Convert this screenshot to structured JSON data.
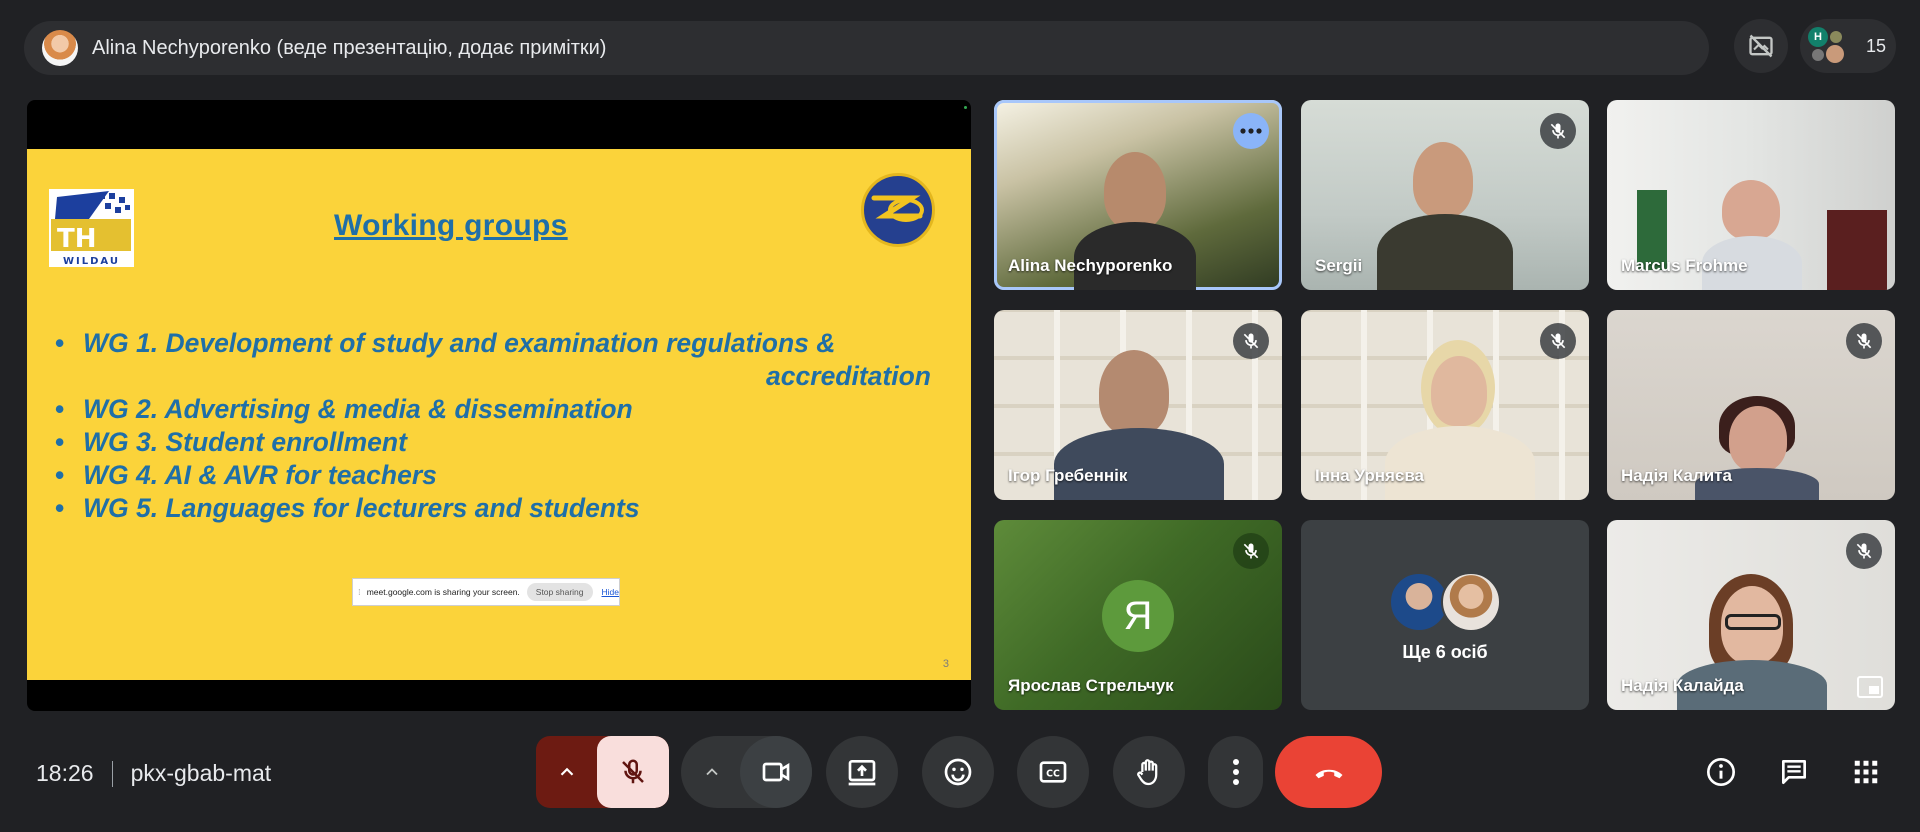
{
  "top_bar": {
    "presenter_text": "Alina Nechyporenko (веде презентацію, додає примітки)",
    "people_count": "15",
    "mini_avatar_letter": "H"
  },
  "presentation": {
    "slide_title": "Working groups",
    "bullets": [
      {
        "text": "WG 1. Development of study and examination regulations &",
        "continuation": "accreditation"
      },
      {
        "text": "WG 2. Advertising & media & dissemination"
      },
      {
        "text": "WG 3. Student enrollment"
      },
      {
        "text": "WG 4. AI & AVR for teachers"
      },
      {
        "text": "WG 5. Languages for lecturers and students"
      }
    ],
    "slide_number": "3",
    "left_logo_text": "WILDAU",
    "share_bar": {
      "message": "meet.google.com is sharing your screen.",
      "stop_label": "Stop sharing",
      "hide_label": "Hide"
    }
  },
  "participants": [
    {
      "name": "Alina Nechyporenko"
    },
    {
      "name": "Sergii"
    },
    {
      "name": "Marcus Frohme"
    },
    {
      "name": "Ігор Гребеннік"
    },
    {
      "name": "Інна Урняєва"
    },
    {
      "name": "Надія Калита"
    },
    {
      "name": "Ярослав Стрельчук",
      "initial": "Я"
    },
    {
      "name": "Ще 6 осіб"
    },
    {
      "name": "Надія Калайда"
    }
  ],
  "bottom_bar": {
    "time": "18:26",
    "meeting_code": "pkx-gbab-mat"
  },
  "colors": {
    "background": "#202124",
    "slide_yellow": "#fbd33a",
    "slide_text_blue": "#1f6fa8",
    "hangup_red": "#ea4335",
    "muted_mic_bg": "#f9dedc",
    "active_speaker_outline": "#a8c7fa"
  }
}
